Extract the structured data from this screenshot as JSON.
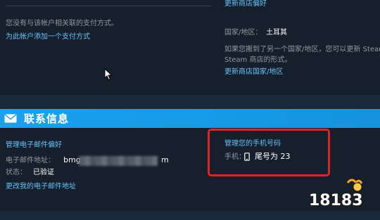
{
  "payment": {
    "no_method": "您没有与该帐户相关联的支付方式。",
    "add_method_link": "为此帐户添加一个支付方式"
  },
  "store": {
    "update_pref_link": "更新商店偏好",
    "country_label": "国家/地区：",
    "country_value": "土耳其",
    "moved_notice_line1": "如果您搬到了另一个国家/地区，您可以更新 Steam",
    "moved_notice_line2": "Steam 商店的形式。",
    "update_country_link": "更新商店国家/地区"
  },
  "contact": {
    "header_title": "联系信息",
    "manage_email_link": "管理电子邮件偏好",
    "email_label": "电子邮件地址：",
    "email_prefix": "bmg",
    "email_suffix": "m",
    "status_label": "状态：",
    "status_value": "已验证",
    "change_email_link": "更改我的电子邮件地址"
  },
  "phone": {
    "manage_link": "管理您的手机号码",
    "label": "手机：",
    "value": "尾号为 23"
  },
  "watermark": {
    "text": "18183"
  },
  "colors": {
    "background": "#1b2838",
    "panel": "#16202d",
    "header_bar": "#1a9fff",
    "link": "#67c1f5",
    "highlight_box": "#e02424"
  },
  "icons": {
    "header": "mail-icon",
    "phone": "mobile-phone-icon",
    "pointer": "mouse-cursor-icon"
  }
}
